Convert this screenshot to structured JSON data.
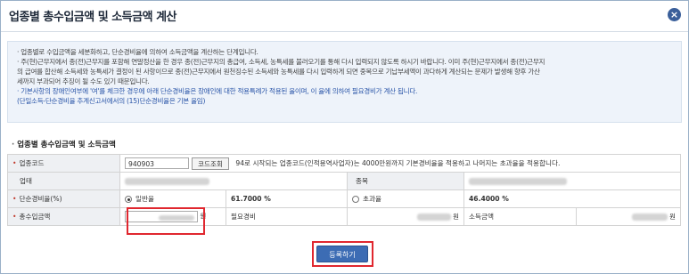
{
  "dialog": {
    "title": "업종별 총수입금액 및 소득금액 계산",
    "close_icon": "close-icon"
  },
  "info": {
    "lines": [
      "· 업종별로 수입금액을 세분화하고, 단순경비율에 의하여 소득금액을 계산하는 단계입니다.",
      "· 주(현)근무지에서 종(전)근무지를 포함해 연말정산을 한 경우 종(전)근무지의 총급여, 소득세, 농특세를 불러오기를 통해 다시 입력되지 않도록 하시기 바랍니다. 이미 주(현)근무지에서 종(전)근무지",
      "  의 급여를 합산해 소득세와 농특세가 결정이 된 사항이므로 종(전)근무지에서 원천징수된 소득세와 농특세를 다시 입력하게 되면 중복으로 기납부세액이 과다하게 계산되는 문제가 발생해 향후 가산",
      "  세까지 부과되어 추징이 될 수도 있기 때문입니다.",
      "· 기본사항의 장애인여부에 '여'를 체크한 경우에 아래 단순경비율은 장애인에 대한 적용특례가 적용된 율이며, 이 율에 의하여 필요경비가 계산 됩니다.",
      "  (단일소득-단순경비율 추계신고서에서의 (15)단순경비율은 기본 율임)"
    ]
  },
  "section": {
    "title": "업종별 총수입금액 및 소득금액"
  },
  "form": {
    "code_label": "업종코드",
    "code_value": "940903",
    "code_button": "코드조회",
    "code_note": "94로 시작되는 업종코드(인적용역사업자)는 4000만원까지 기본경비율을 적용하고 나머지는 초과율을 적용합니다.",
    "industry_label": "업태",
    "category_label": "종목",
    "rate_label": "단순경비율(%)",
    "rate_general_label": "일반율",
    "rate_general_value": "61.7000 %",
    "rate_excess_label": "초과율",
    "rate_excess_value": "46.4000 %",
    "rate_selected": "일반율",
    "income_label": "총수입금액",
    "won_1": "원",
    "expense_label": "필요경비",
    "won_2": "원",
    "profit_label": "소득금액",
    "won_3": "원"
  },
  "actions": {
    "register_button": "등록하기"
  },
  "colors": {
    "accent": "#3c6cb4",
    "highlight": "#e0272f",
    "required": "#c0392b"
  }
}
